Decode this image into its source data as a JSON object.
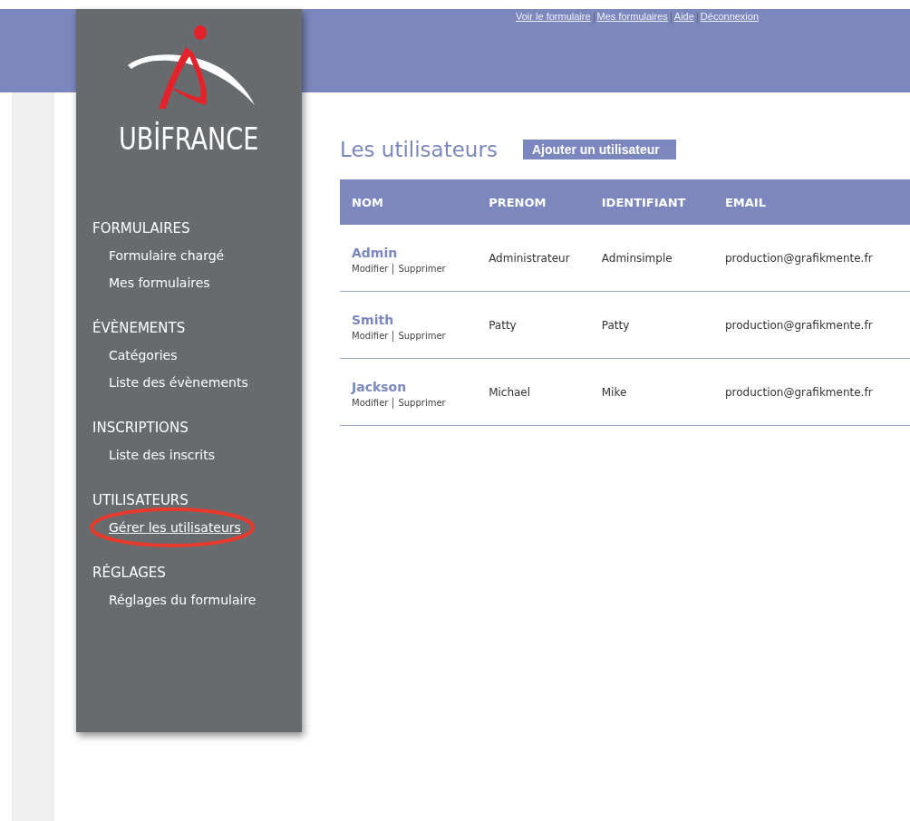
{
  "top_links": [
    "Voir le formulaire",
    "Mes formulaires",
    "Aide",
    "Déconnexion"
  ],
  "logo": {
    "text": "UBİFRANCE"
  },
  "sidebar": {
    "sections": [
      {
        "title": "FORMULAIRES",
        "items": [
          {
            "label": "Formulaire chargé",
            "selected": false,
            "circled": false
          },
          {
            "label": "Mes formulaires",
            "selected": false,
            "circled": false
          }
        ]
      },
      {
        "title": "ÉVÈNEMENTS",
        "items": [
          {
            "label": "Catégories",
            "selected": false,
            "circled": false
          },
          {
            "label": "Liste des évènements",
            "selected": false,
            "circled": false
          }
        ]
      },
      {
        "title": "INSCRIPTIONS",
        "items": [
          {
            "label": "Liste des inscrits",
            "selected": false,
            "circled": false
          }
        ]
      },
      {
        "title": "UTILISATEURS",
        "items": [
          {
            "label": "Gérer les utilisateurs",
            "selected": true,
            "circled": true
          }
        ]
      },
      {
        "title": "RÉGLAGES",
        "items": [
          {
            "label": "Réglages du formulaire",
            "selected": false,
            "circled": false
          }
        ]
      }
    ]
  },
  "page_title": "Les utilisateurs",
  "add_button": "Ajouter un utilisateur",
  "table": {
    "columns": [
      "NOM",
      "PRENOM",
      "IDENTIFIANT",
      "EMAIL"
    ],
    "rows": [
      {
        "nom": "Admin",
        "actions": [
          "Modifier",
          "Supprimer"
        ],
        "prenom": "Administrateur",
        "identifiant": "Adminsimple",
        "email": "production@grafikmente.fr"
      },
      {
        "nom": "Smith",
        "actions": [
          "Modifier",
          "Supprimer"
        ],
        "prenom": "Patty",
        "identifiant": "Patty",
        "email": "production@grafikmente.fr"
      },
      {
        "nom": "Jackson",
        "actions": [
          "Modifier",
          "Supprimer"
        ],
        "prenom": "Michael",
        "identifiant": "Mike",
        "email": "production@grafikmente.fr"
      }
    ]
  }
}
